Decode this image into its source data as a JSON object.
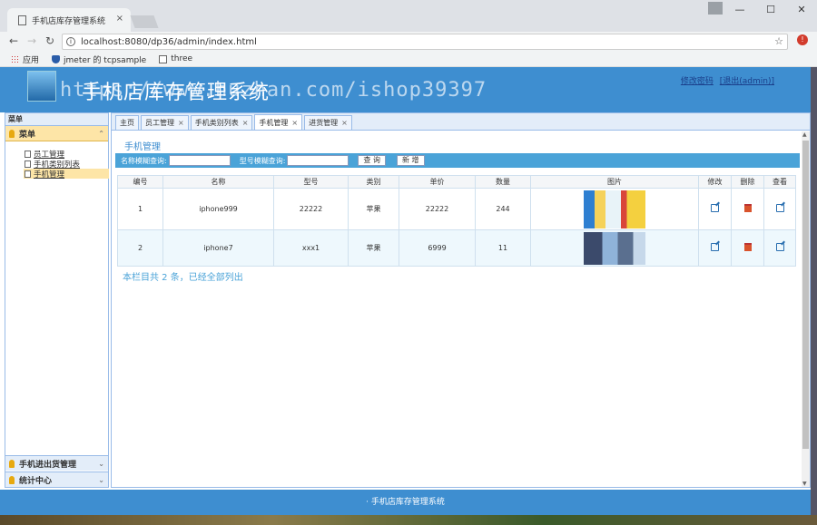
{
  "browser": {
    "tab_title": "手机店库存管理系统",
    "tab_close": "×",
    "url": "localhost:8080/dp36/admin/index.html",
    "url_prefix": "localhost",
    "bookmarks": [
      "应用",
      "jmeter 的 tcpsample",
      "three"
    ],
    "window_controls": [
      "—",
      "☐",
      "✕"
    ]
  },
  "header": {
    "title": "手机店库存管理系统",
    "watermark": "https://www.huzhan.com/ishop39397",
    "link_change_password": "修改密码",
    "link_logout": "[退出(admin)]"
  },
  "sidebar": {
    "caption": "菜单",
    "group_title": "菜单",
    "items": [
      {
        "label": "员工管理",
        "active": false
      },
      {
        "label": "手机类别列表",
        "active": false
      },
      {
        "label": "手机管理",
        "active": true
      }
    ],
    "bottom_groups": [
      "手机进出货管理",
      "统计中心"
    ]
  },
  "tabs": [
    {
      "label": "主页",
      "closable": false,
      "active": false
    },
    {
      "label": "员工管理",
      "closable": true,
      "active": false
    },
    {
      "label": "手机类别列表",
      "closable": true,
      "active": false
    },
    {
      "label": "手机管理",
      "closable": true,
      "active": true
    },
    {
      "label": "进货管理",
      "closable": true,
      "active": false
    }
  ],
  "main": {
    "section_title": "手机管理",
    "search": {
      "name_label": "名称模糊查询:",
      "model_label": "型号模糊查询:",
      "query_button": "查 询",
      "add_button": "新 增"
    },
    "columns": [
      "编号",
      "名称",
      "型号",
      "类别",
      "单价",
      "数量",
      "图片",
      "修改",
      "删除",
      "查看"
    ],
    "rows": [
      {
        "id": "1",
        "name": "iphone999",
        "model": "22222",
        "category": "苹果",
        "price": "22222",
        "qty": "244"
      },
      {
        "id": "2",
        "name": "iphone7",
        "model": "xxx1",
        "category": "苹果",
        "price": "6999",
        "qty": "11"
      }
    ],
    "summary": "本栏目共 2 条，已经全部列出"
  },
  "footer": {
    "text": "· 手机店库存管理系统"
  }
}
